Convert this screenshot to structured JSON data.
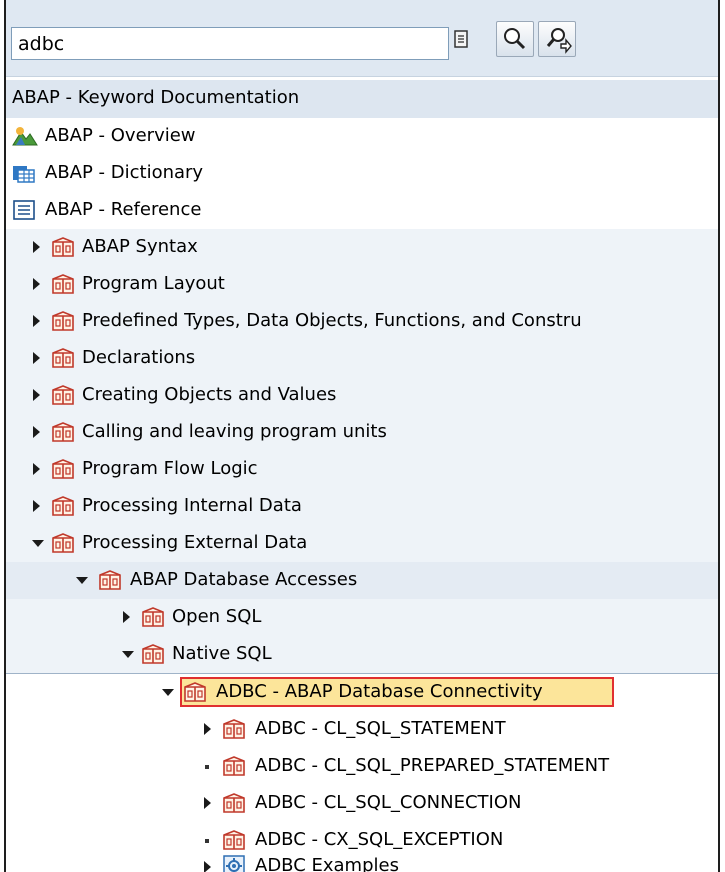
{
  "search": {
    "value": "adbc"
  },
  "tree": {
    "root": {
      "label": "ABAP - Keyword Documentation"
    },
    "overview": {
      "label": "ABAP - Overview"
    },
    "dictionary": {
      "label": "ABAP - Dictionary"
    },
    "reference": {
      "label": "ABAP - Reference"
    },
    "syntax": {
      "label": "ABAP Syntax"
    },
    "layout": {
      "label": "Program Layout"
    },
    "types": {
      "label": "Predefined Types, Data Objects, Functions, and Constru"
    },
    "declarations": {
      "label": "Declarations"
    },
    "creating": {
      "label": "Creating Objects and Values"
    },
    "calling": {
      "label": "Calling and leaving program units"
    },
    "flow": {
      "label": "Program Flow Logic"
    },
    "internal": {
      "label": "Processing Internal Data"
    },
    "external": {
      "label": "Processing External Data"
    },
    "db_access": {
      "label": "ABAP Database Accesses"
    },
    "open_sql": {
      "label": "Open SQL"
    },
    "native_sql": {
      "label": "Native SQL"
    },
    "adbc": {
      "label": "ADBC - ABAP Database Connectivity"
    },
    "statement": {
      "label": "ADBC - CL_SQL_STATEMENT"
    },
    "prepared": {
      "label": "ADBC - CL_SQL_PREPARED_STATEMENT"
    },
    "connection": {
      "label": "ADBC - CL_SQL_CONNECTION"
    },
    "exception": {
      "label": "ADBC - CX_SQL_EXCEPTION"
    },
    "examples": {
      "label": "ADBC Examples"
    }
  },
  "colors": {
    "toolbar_bg": "#dfe8f2",
    "header_bg": "#dde6f0",
    "alt_bg": "#eef3f8",
    "selected_bg": "#fce59a",
    "selected_border": "#e03030",
    "book_icon": "#c0392b"
  },
  "icons": {
    "menu": "document-menu-icon",
    "find": "search-icon",
    "find_next": "search-next-icon"
  }
}
